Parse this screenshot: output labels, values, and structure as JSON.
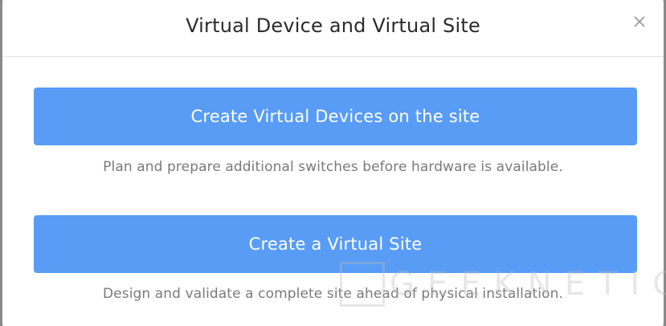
{
  "dialog": {
    "title": "Virtual Device and Virtual Site",
    "close_icon": "close-icon"
  },
  "options": [
    {
      "button_label": "Create Virtual Devices on the site",
      "description": "Plan and prepare additional switches before hardware is available."
    },
    {
      "button_label": "Create a Virtual Site",
      "description": "Design and validate a complete site ahead of physical installation."
    }
  ],
  "watermark": {
    "text": "GEEKNETIC"
  },
  "colors": {
    "button_bg": "#589cf6",
    "button_text": "#ffffff",
    "title": "#2b2b2b",
    "description": "#7a7a7a",
    "backdrop": "#8a8a8a"
  }
}
